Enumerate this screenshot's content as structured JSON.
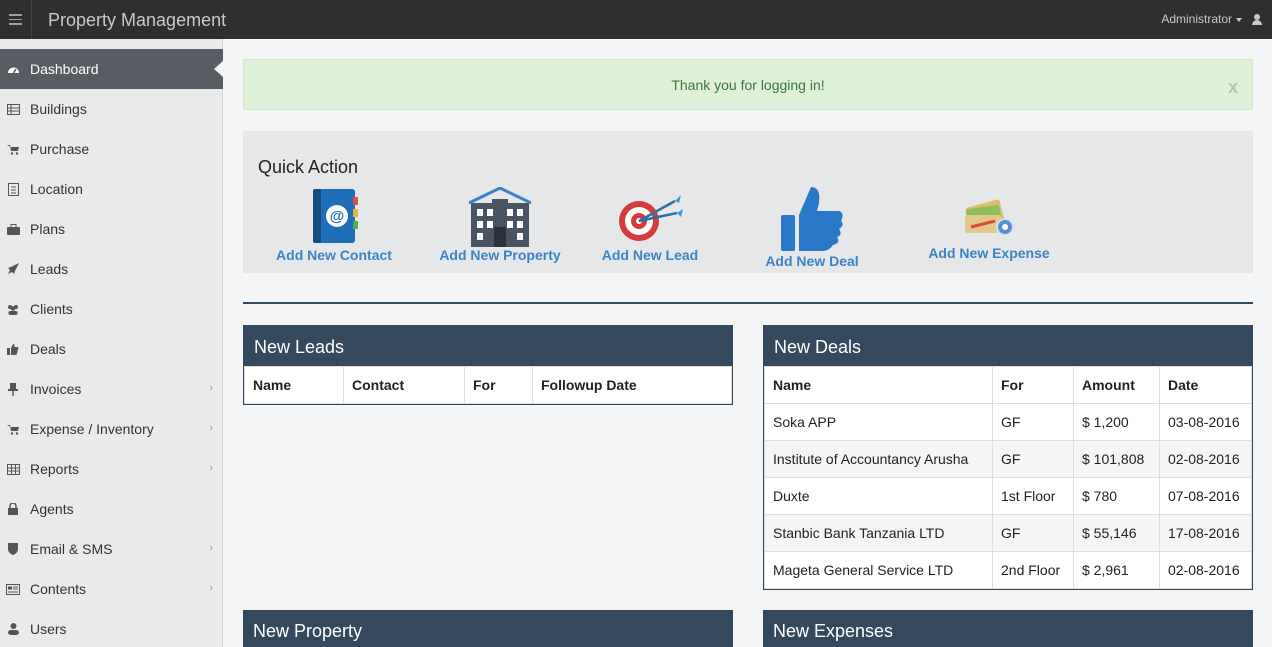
{
  "app": {
    "title": "Property Management",
    "user": "Administrator"
  },
  "sidebar": {
    "items": [
      {
        "label": "Dashboard",
        "icon": "dashboard-icon",
        "active": true
      },
      {
        "label": "Buildings",
        "icon": "buildings-icon"
      },
      {
        "label": "Purchase",
        "icon": "cart-icon"
      },
      {
        "label": "Location",
        "icon": "location-icon"
      },
      {
        "label": "Plans",
        "icon": "briefcase-icon"
      },
      {
        "label": "Leads",
        "icon": "rocket-icon"
      },
      {
        "label": "Clients",
        "icon": "users-icon"
      },
      {
        "label": "Deals",
        "icon": "thumbs-up-icon"
      },
      {
        "label": "Invoices",
        "icon": "pin-icon",
        "submenu": true
      },
      {
        "label": "Expense / Inventory",
        "icon": "cart-icon",
        "submenu": true
      },
      {
        "label": "Reports",
        "icon": "table-icon",
        "submenu": true
      },
      {
        "label": "Agents",
        "icon": "lock-icon"
      },
      {
        "label": "Email & SMS",
        "icon": "shield-icon",
        "submenu": true
      },
      {
        "label": "Contents",
        "icon": "newspaper-icon",
        "submenu": true
      },
      {
        "label": "Users",
        "icon": "user-icon"
      }
    ]
  },
  "alert": {
    "message": "Thank you for logging in!",
    "close": "x"
  },
  "quick_action": {
    "title": "Quick Action",
    "actions": [
      {
        "label": "Add New Contact",
        "icon": "address-book-icon"
      },
      {
        "label": "Add New Property",
        "icon": "building-icon"
      },
      {
        "label": "Add New Lead",
        "icon": "target-icon"
      },
      {
        "label": "Add New Deal",
        "icon": "thumbs-up-icon"
      },
      {
        "label": "Add New Expense",
        "icon": "money-icon"
      }
    ]
  },
  "new_leads": {
    "title": "New Leads",
    "columns": [
      "Name",
      "Contact",
      "For",
      "Followup Date"
    ]
  },
  "new_deals": {
    "title": "New Deals",
    "columns": [
      "Name",
      "For",
      "Amount",
      "Date"
    ],
    "rows": [
      [
        "Soka APP",
        "GF",
        "$ 1,200",
        "03-08-2016"
      ],
      [
        "Institute of Accountancy Arusha",
        "GF",
        "$ 101,808",
        "02-08-2016"
      ],
      [
        "Duxte",
        "1st Floor",
        "$ 780",
        "07-08-2016"
      ],
      [
        "Stanbic Bank Tanzania LTD",
        "GF",
        "$ 55,146",
        "17-08-2016"
      ],
      [
        "Mageta General Service LTD",
        "2nd Floor",
        "$ 2,961",
        "02-08-2016"
      ]
    ]
  },
  "new_property": {
    "title": "New Property"
  },
  "new_expenses": {
    "title": "New Expenses"
  },
  "colors": {
    "panel_header": "#34495e",
    "link": "#3b83c6",
    "alert_bg": "#dff0d8",
    "topbar": "#2f2f2f"
  }
}
